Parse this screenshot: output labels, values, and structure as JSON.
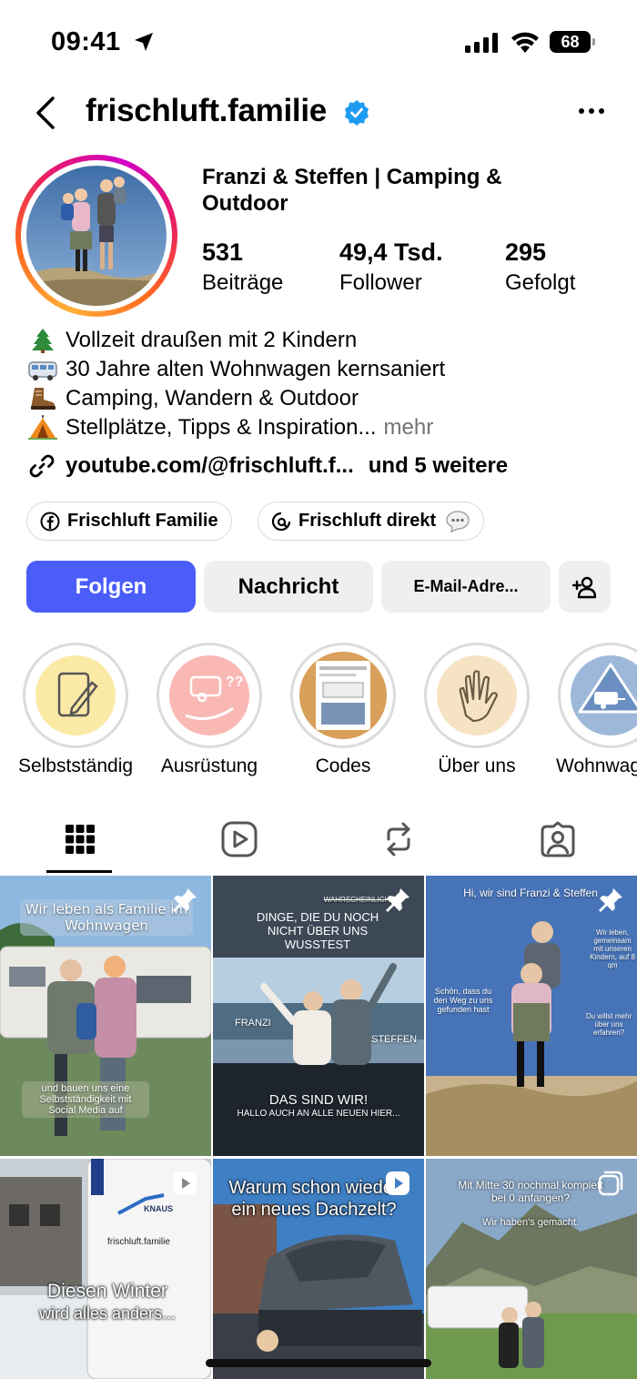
{
  "status_bar": {
    "time": "09:41",
    "battery": "68"
  },
  "header": {
    "username": "frischluft.familie",
    "verified": true
  },
  "profile": {
    "display_name": "Franzi & Steffen | Camping & Outdoor",
    "stats": [
      {
        "value": "531",
        "label": "Beiträge"
      },
      {
        "value": "49,4 Tsd.",
        "label": "Follower"
      },
      {
        "value": "295",
        "label": "Gefolgt"
      }
    ],
    "bio": [
      {
        "icon": "pine-tree-icon",
        "text": "Vollzeit draußen mit 2 Kindern"
      },
      {
        "icon": "minibus-icon",
        "text": "30 Jahre alten Wohnwagen kernsaniert"
      },
      {
        "icon": "hiking-boot-icon",
        "text": "Camping, Wandern & Outdoor"
      },
      {
        "icon": "tent-icon",
        "text": "Stellplätze, Tipps & Inspiration..."
      }
    ],
    "bio_more": "mehr",
    "link": "youtube.com/@frischluft.f...",
    "link_extra": "und 5 weitere"
  },
  "chips": [
    {
      "label": "Frischluft Familie",
      "icon": "facebook-icon"
    },
    {
      "label": "Frischluft direkt",
      "icon": "threads-icon",
      "trailing_icon": "speech-bubble-icon"
    }
  ],
  "actions": {
    "follow": "Folgen",
    "message": "Nachricht",
    "email": "E-Mail-Adre..."
  },
  "highlights": [
    {
      "label": "Selbstständig",
      "bg": "#fbe9a6"
    },
    {
      "label": "Ausrüstung",
      "bg": "#f9b8b4"
    },
    {
      "label": "Codes",
      "bg": "#d9a05b"
    },
    {
      "label": "Über uns",
      "bg": "#f6e3c4"
    },
    {
      "label": "Wohnwag",
      "bg": "#9db8d8"
    }
  ],
  "posts": [
    {
      "caption_top": "Wir leben als Familie im Wohnwagen",
      "caption_bottom": "und bauen uns eine Selbstständigkeit mit Social Media auf",
      "pinned": true
    },
    {
      "caption_top": "DINGE, DIE DU NOCH NICHT ÜBER UNS WUSSTEST",
      "tag_small": "WAHRSCHEINLICH",
      "label_left": "FRANZI",
      "label_right": "STEFFEN",
      "caption_bottom": "DAS SIND WIR!",
      "caption_bottom2": "HALLO AUCH AN ALLE NEUEN HIER...",
      "pinned": true
    },
    {
      "caption_top": "Hi, wir sind Franzi & Steffen",
      "side_left": "Schön, dass du den Weg zu uns gefunden hast",
      "side_right": "Wir leben, gemeinsam mit unseren Kindern, auf 8 qm",
      "side_right2": "Du willst mehr über uns erfahren?",
      "pinned": true
    },
    {
      "caption_main": "Diesen Winter",
      "caption_main2": "wird alles anders...",
      "brand": "frischluft.familie",
      "van_brand": "KNAUS",
      "reel": true
    },
    {
      "caption_main": "Warum schon wieder ein neues Dachzelt?",
      "reel": true
    },
    {
      "caption_top": "Mit Mitte 30 nochmal komplett bei 0 anfangen?",
      "caption_top2": "Wir haben's gemacht.",
      "multi": true
    }
  ]
}
